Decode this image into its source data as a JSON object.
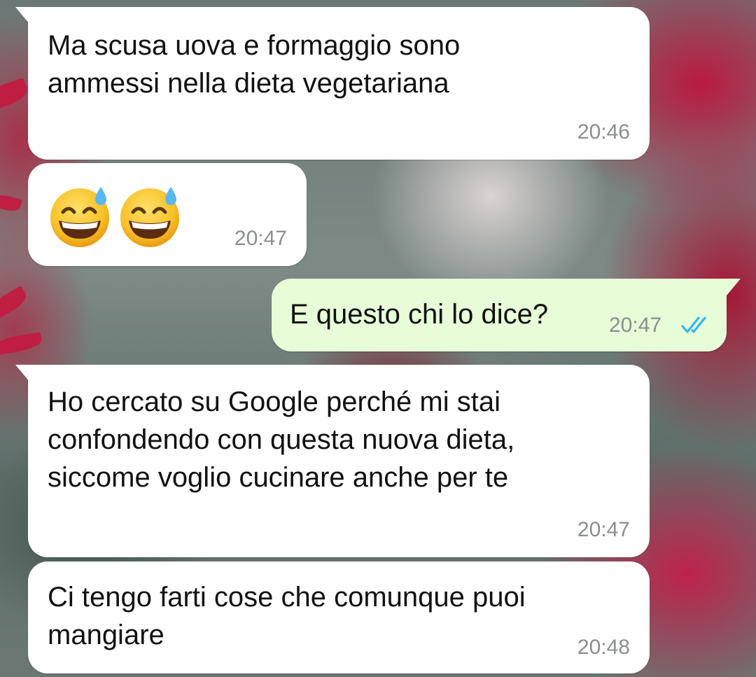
{
  "chat": {
    "messages": [
      {
        "direction": "incoming",
        "text": "Ma scusa uova e formaggio sono\nammessi nella dieta vegetariana",
        "time": "20:46"
      },
      {
        "direction": "incoming",
        "emoji": [
          "grinning-face-with-sweat",
          "grinning-face-with-sweat"
        ],
        "time": "20:47"
      },
      {
        "direction": "outgoing",
        "text": "E questo chi lo dice?",
        "time": "20:47",
        "status": "read"
      },
      {
        "direction": "incoming",
        "text": "Ho cercato su Google perché mi stai\nconfondendo con questa nuova dieta,\nsiccome voglio cucinare anche per te",
        "time": "20:47"
      },
      {
        "direction": "incoming",
        "text": "Ci tengo farti cose che comunque puoi\nmangiare",
        "time": "20:48"
      }
    ]
  },
  "colors": {
    "incoming_bubble": "#ffffff",
    "outgoing_bubble": "#e7fdd8",
    "timestamp": "#8a8f8e",
    "read_ticks": "#34b7f1"
  }
}
